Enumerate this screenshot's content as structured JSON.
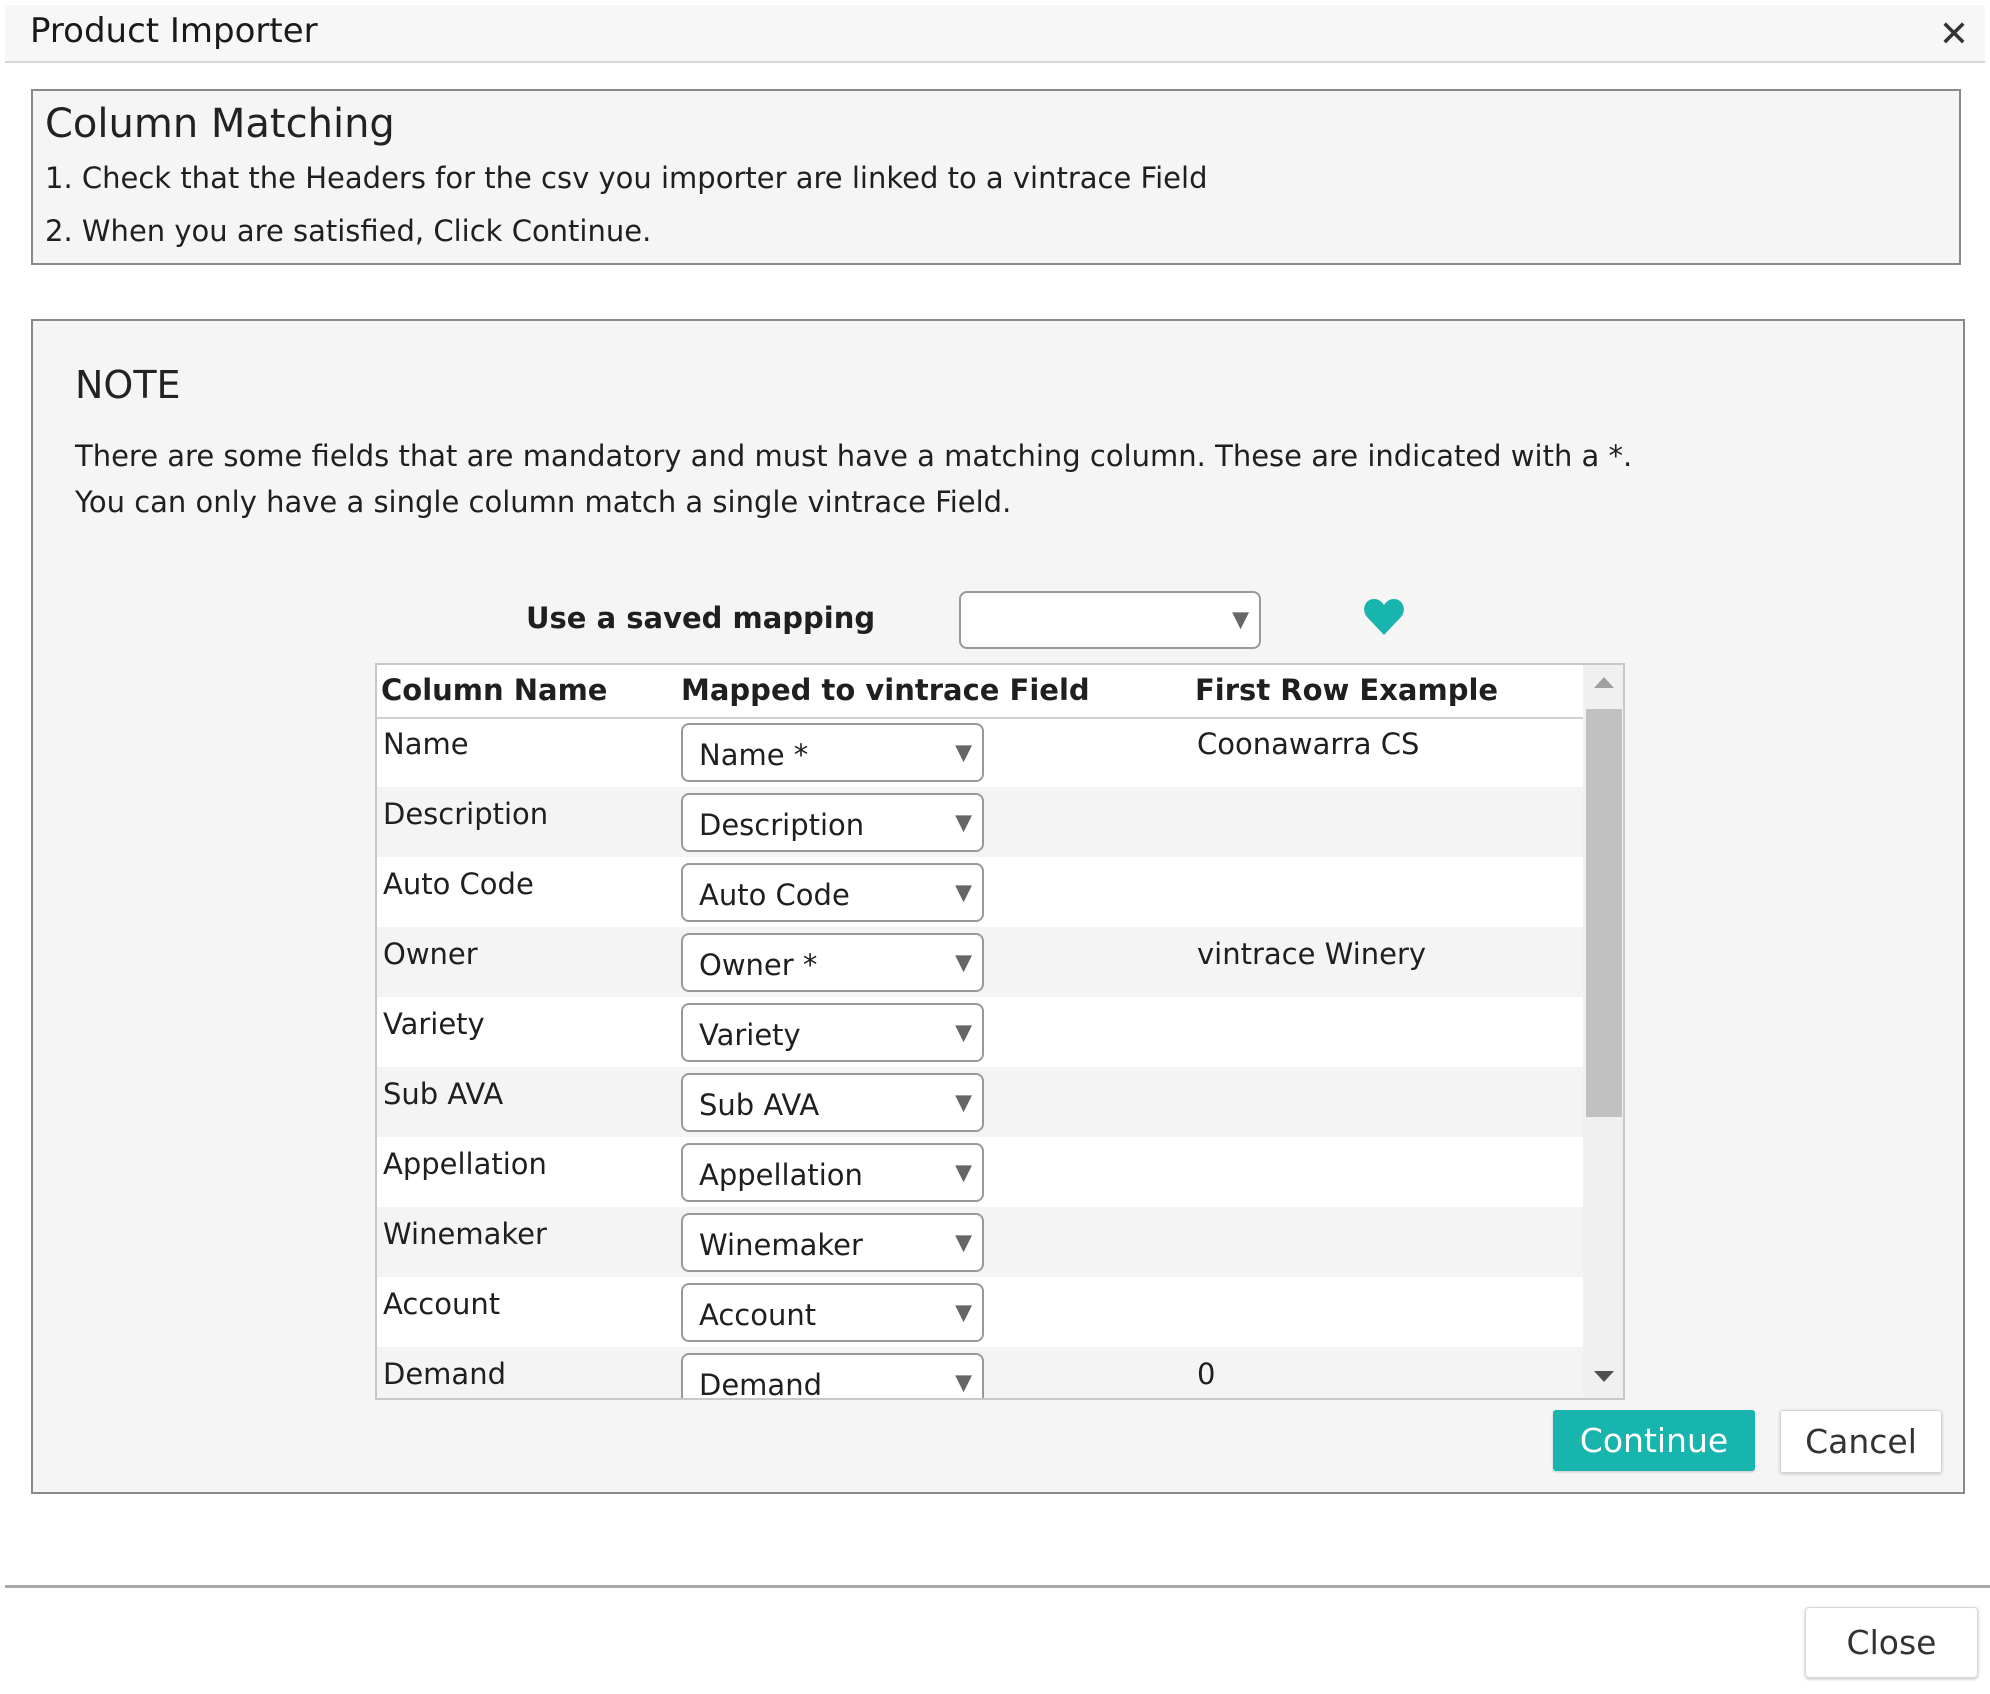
{
  "window": {
    "title": "Product Importer",
    "close_icon": "close-icon"
  },
  "instructions": {
    "heading": "Column Matching",
    "step1": "1. Check that the Headers for the csv you importer are linked to a vintrace Field",
    "step2": "2. When you are satisfied, Click Continue."
  },
  "note": {
    "title": "NOTE",
    "line1": "There are some fields that are mandatory and must have a matching column. These are indicated with a *.",
    "line2": "You can only have a single column match a single vintrace Field."
  },
  "saved_mapping": {
    "label": "Use a saved mapping",
    "value": "",
    "favorite_icon": "heart-icon",
    "accent": "#17b5ad"
  },
  "table": {
    "headers": [
      "Column Name",
      "Mapped to vintrace Field",
      "First Row Example"
    ],
    "rows": [
      {
        "column": "Name",
        "mapped": "Name *",
        "example": "Coonawarra CS"
      },
      {
        "column": "Description",
        "mapped": "Description",
        "example": ""
      },
      {
        "column": "Auto Code",
        "mapped": "Auto Code",
        "example": ""
      },
      {
        "column": "Owner",
        "mapped": "Owner *",
        "example": "vintrace Winery"
      },
      {
        "column": "Variety",
        "mapped": "Variety",
        "example": ""
      },
      {
        "column": "Sub AVA",
        "mapped": "Sub AVA",
        "example": ""
      },
      {
        "column": "Appellation",
        "mapped": "Appellation",
        "example": ""
      },
      {
        "column": "Winemaker",
        "mapped": "Winemaker",
        "example": ""
      },
      {
        "column": "Account",
        "mapped": "Account",
        "example": ""
      },
      {
        "column": "Demand",
        "mapped": "Demand",
        "example": "0"
      }
    ]
  },
  "buttons": {
    "continue": "Continue",
    "cancel": "Cancel",
    "close": "Close"
  },
  "colors": {
    "accent": "#17b5ad"
  }
}
